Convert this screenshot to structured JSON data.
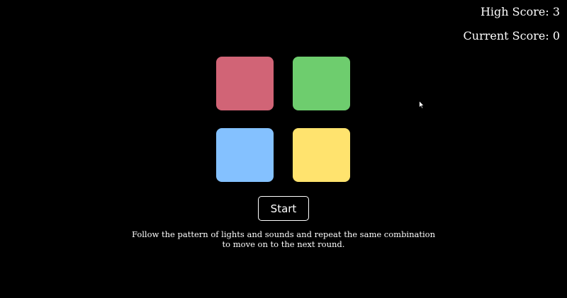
{
  "scores": {
    "high_label": "High Score:",
    "high_value": "3",
    "current_label": "Current Score:",
    "current_value": "0"
  },
  "pads": {
    "red": {
      "color": "#d16476"
    },
    "green": {
      "color": "#6ecd6e"
    },
    "blue": {
      "color": "#84c1ff"
    },
    "yellow": {
      "color": "#ffe36e"
    }
  },
  "controls": {
    "start_label": "Start"
  },
  "instructions": {
    "text": "Follow the pattern of lights and sounds and repeat the same combination to move on to the next round."
  }
}
